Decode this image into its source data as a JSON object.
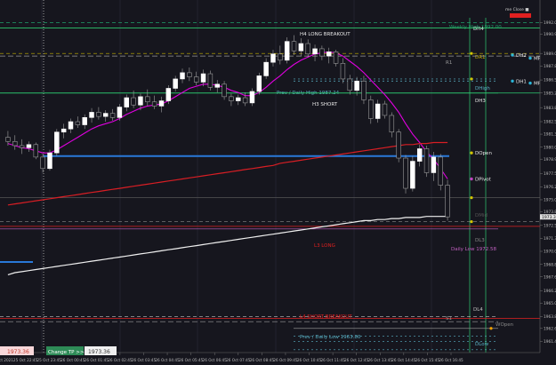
{
  "header": {
    "status": "me Close ■"
  },
  "price_axis": {
    "ticks": [
      1992.0,
      1990.9,
      1989.05,
      1987.85,
      1986.5,
      1985.25,
      1983.85,
      1982.5,
      1981.3,
      1980.05,
      1978.9,
      1977.5,
      1976.25,
      1975.0,
      1973.85,
      1972.55,
      1971.3,
      1970.05,
      1968.8,
      1967.6,
      1966.25,
      1965.05,
      1963.8,
      1962.65,
      1961.4
    ]
  },
  "time_axis": {
    "ticks": [
      "25 Oct 2021",
      "25 Oct 22:45",
      "25 Oct 23:45",
      "26 Oct 00:45",
      "26 Oct 01:45",
      "26 Oct 02:45",
      "26 Oct 03:45",
      "26 Oct 04:45",
      "26 Oct 05:45",
      "26 Oct 06:45",
      "26 Oct 07:45",
      "26 Oct 08:45",
      "26 Oct 09:45",
      "26 Oct 10:45",
      "26 Oct 11:45",
      "26 Oct 12:45",
      "26 Oct 13:45",
      "26 Oct 14:45",
      "26 Oct 15:45",
      "26 Oct 16:45"
    ]
  },
  "bottom_bar": {
    "left_value": "1973.36",
    "tp_label": "Change TP >>>>",
    "tp_value": "1973.36"
  },
  "chart_data": {
    "type": "candlestick",
    "title": "",
    "ylim": [
      1960.5,
      1993.5
    ],
    "grid": false,
    "candles": [
      {
        "o": 1981.0,
        "h": 1981.6,
        "l": 1980.2,
        "c": 1980.6
      },
      {
        "o": 1980.6,
        "h": 1981.2,
        "l": 1979.8,
        "c": 1980.2
      },
      {
        "o": 1980.2,
        "h": 1980.8,
        "l": 1979.4,
        "c": 1980.0
      },
      {
        "o": 1980.0,
        "h": 1980.6,
        "l": 1979.6,
        "c": 1980.3
      },
      {
        "o": 1980.3,
        "h": 1980.5,
        "l": 1978.9,
        "c": 1979.1
      },
      {
        "o": 1979.1,
        "h": 1979.4,
        "l": 1977.6,
        "c": 1978.0
      },
      {
        "o": 1978.0,
        "h": 1979.8,
        "l": 1977.8,
        "c": 1979.5
      },
      {
        "o": 1979.5,
        "h": 1981.8,
        "l": 1979.2,
        "c": 1981.5
      },
      {
        "o": 1981.5,
        "h": 1982.3,
        "l": 1980.9,
        "c": 1981.8
      },
      {
        "o": 1981.8,
        "h": 1982.8,
        "l": 1981.4,
        "c": 1982.5
      },
      {
        "o": 1982.5,
        "h": 1983.0,
        "l": 1981.9,
        "c": 1982.2
      },
      {
        "o": 1982.2,
        "h": 1983.2,
        "l": 1981.8,
        "c": 1982.9
      },
      {
        "o": 1982.9,
        "h": 1983.8,
        "l": 1982.4,
        "c": 1983.4
      },
      {
        "o": 1983.4,
        "h": 1983.9,
        "l": 1982.7,
        "c": 1983.0
      },
      {
        "o": 1983.0,
        "h": 1983.6,
        "l": 1982.5,
        "c": 1983.3
      },
      {
        "o": 1983.3,
        "h": 1983.7,
        "l": 1982.6,
        "c": 1982.9
      },
      {
        "o": 1982.9,
        "h": 1984.2,
        "l": 1982.6,
        "c": 1983.9
      },
      {
        "o": 1983.9,
        "h": 1985.1,
        "l": 1983.5,
        "c": 1984.8
      },
      {
        "o": 1984.8,
        "h": 1985.5,
        "l": 1983.8,
        "c": 1984.1
      },
      {
        "o": 1984.1,
        "h": 1985.2,
        "l": 1983.6,
        "c": 1984.9
      },
      {
        "o": 1984.9,
        "h": 1985.6,
        "l": 1984.0,
        "c": 1984.4
      },
      {
        "o": 1984.4,
        "h": 1985.0,
        "l": 1983.7,
        "c": 1984.0
      },
      {
        "o": 1984.0,
        "h": 1984.9,
        "l": 1983.4,
        "c": 1984.5
      },
      {
        "o": 1984.5,
        "h": 1986.0,
        "l": 1984.2,
        "c": 1985.7
      },
      {
        "o": 1985.7,
        "h": 1986.9,
        "l": 1985.4,
        "c": 1986.6
      },
      {
        "o": 1986.6,
        "h": 1987.6,
        "l": 1986.2,
        "c": 1987.2
      },
      {
        "o": 1987.2,
        "h": 1987.7,
        "l": 1986.4,
        "c": 1986.8
      },
      {
        "o": 1986.8,
        "h": 1987.3,
        "l": 1986.0,
        "c": 1986.3
      },
      {
        "o": 1986.3,
        "h": 1987.5,
        "l": 1985.9,
        "c": 1987.1
      },
      {
        "o": 1987.1,
        "h": 1987.4,
        "l": 1985.5,
        "c": 1985.8
      },
      {
        "o": 1985.8,
        "h": 1986.5,
        "l": 1985.3,
        "c": 1986.1
      },
      {
        "o": 1986.1,
        "h": 1986.4,
        "l": 1984.6,
        "c": 1984.9
      },
      {
        "o": 1984.9,
        "h": 1985.2,
        "l": 1984.0,
        "c": 1984.5
      },
      {
        "o": 1984.5,
        "h": 1985.1,
        "l": 1984.1,
        "c": 1984.8
      },
      {
        "o": 1984.8,
        "h": 1985.3,
        "l": 1984.0,
        "c": 1984.3
      },
      {
        "o": 1984.3,
        "h": 1985.7,
        "l": 1984.0,
        "c": 1985.4
      },
      {
        "o": 1985.4,
        "h": 1987.2,
        "l": 1985.1,
        "c": 1986.9
      },
      {
        "o": 1986.9,
        "h": 1988.6,
        "l": 1986.6,
        "c": 1988.2
      },
      {
        "o": 1988.2,
        "h": 1989.4,
        "l": 1987.8,
        "c": 1989.0
      },
      {
        "o": 1989.0,
        "h": 1989.8,
        "l": 1988.0,
        "c": 1988.4
      },
      {
        "o": 1988.4,
        "h": 1990.6,
        "l": 1988.1,
        "c": 1990.2
      },
      {
        "o": 1990.2,
        "h": 1990.8,
        "l": 1988.9,
        "c": 1989.3
      },
      {
        "o": 1989.3,
        "h": 1990.5,
        "l": 1988.8,
        "c": 1990.0
      },
      {
        "o": 1990.0,
        "h": 1990.4,
        "l": 1988.7,
        "c": 1989.0
      },
      {
        "o": 1989.0,
        "h": 1989.9,
        "l": 1988.3,
        "c": 1989.5
      },
      {
        "o": 1989.5,
        "h": 1989.8,
        "l": 1988.4,
        "c": 1988.8
      },
      {
        "o": 1988.8,
        "h": 1989.6,
        "l": 1988.1,
        "c": 1989.2
      },
      {
        "o": 1989.2,
        "h": 1989.4,
        "l": 1987.8,
        "c": 1988.1
      },
      {
        "o": 1988.1,
        "h": 1988.6,
        "l": 1986.2,
        "c": 1986.6
      },
      {
        "o": 1986.6,
        "h": 1987.0,
        "l": 1985.1,
        "c": 1985.5
      },
      {
        "o": 1985.5,
        "h": 1986.8,
        "l": 1985.0,
        "c": 1986.4
      },
      {
        "o": 1986.4,
        "h": 1986.9,
        "l": 1984.2,
        "c": 1984.6
      },
      {
        "o": 1984.6,
        "h": 1985.0,
        "l": 1982.3,
        "c": 1982.8
      },
      {
        "o": 1982.8,
        "h": 1984.6,
        "l": 1982.4,
        "c": 1984.2
      },
      {
        "o": 1984.2,
        "h": 1984.5,
        "l": 1982.8,
        "c": 1983.1
      },
      {
        "o": 1983.1,
        "h": 1983.4,
        "l": 1981.0,
        "c": 1981.5
      },
      {
        "o": 1981.5,
        "h": 1981.8,
        "l": 1978.6,
        "c": 1979.0
      },
      {
        "o": 1979.0,
        "h": 1979.3,
        "l": 1975.6,
        "c": 1976.1
      },
      {
        "o": 1976.1,
        "h": 1979.2,
        "l": 1975.8,
        "c": 1978.7
      },
      {
        "o": 1978.7,
        "h": 1980.3,
        "l": 1978.2,
        "c": 1979.9
      },
      {
        "o": 1979.9,
        "h": 1980.2,
        "l": 1977.2,
        "c": 1977.6
      },
      {
        "o": 1977.6,
        "h": 1979.6,
        "l": 1976.8,
        "c": 1979.1
      },
      {
        "o": 1979.1,
        "h": 1979.4,
        "l": 1975.9,
        "c": 1976.4
      },
      {
        "o": 1976.4,
        "h": 1976.9,
        "l": 1973.0,
        "c": 1973.36
      }
    ],
    "indicators": [
      {
        "name": "",
        "color": "#e000e0",
        "values": [
          1980.4,
          1980.2,
          1980.0,
          1979.9,
          1979.7,
          1979.5,
          1979.5,
          1979.8,
          1980.2,
          1980.6,
          1981.0,
          1981.4,
          1981.8,
          1982.1,
          1982.3,
          1982.5,
          1982.8,
          1983.2,
          1983.5,
          1983.8,
          1984.0,
          1984.1,
          1984.2,
          1984.5,
          1984.9,
          1985.3,
          1985.7,
          1985.9,
          1986.1,
          1986.1,
          1986.0,
          1985.8,
          1985.5,
          1985.3,
          1985.0,
          1985.0,
          1985.3,
          1985.8,
          1986.4,
          1986.9,
          1987.5,
          1988.0,
          1988.4,
          1988.7,
          1989.0,
          1989.1,
          1989.2,
          1989.1,
          1988.8,
          1988.3,
          1987.8,
          1987.2,
          1986.5,
          1985.8,
          1985.1,
          1984.3,
          1983.4,
          1982.3,
          1981.3,
          1980.5,
          1979.6,
          1978.9,
          1978.0,
          1977.0
        ]
      },
      {
        "name": "",
        "color": "#d81e24",
        "values": [
          1974.5,
          1974.6,
          1974.7,
          1974.8,
          1974.9,
          1975.0,
          1975.1,
          1975.2,
          1975.3,
          1975.4,
          1975.5,
          1975.6,
          1975.7,
          1975.8,
          1975.9,
          1976.0,
          1976.1,
          1976.2,
          1976.3,
          1976.4,
          1976.5,
          1976.6,
          1976.7,
          1976.8,
          1976.9,
          1977.0,
          1977.1,
          1977.2,
          1977.3,
          1977.4,
          1977.5,
          1977.6,
          1977.7,
          1977.8,
          1977.9,
          1978.0,
          1978.1,
          1978.2,
          1978.3,
          1978.5,
          1978.6,
          1978.7,
          1978.8,
          1978.9,
          1979.0,
          1979.1,
          1979.2,
          1979.3,
          1979.4,
          1979.5,
          1979.6,
          1979.7,
          1979.8,
          1979.9,
          1980.0,
          1980.1,
          1980.2,
          1980.3,
          1980.3,
          1980.4,
          1980.4,
          1980.5,
          1980.5,
          1980.5
        ]
      },
      {
        "name": "",
        "color": "#f0f0f0",
        "values": [
          1967.8,
          1968.0,
          1968.1,
          1968.2,
          1968.3,
          1968.4,
          1968.5,
          1968.6,
          1968.7,
          1968.8,
          1968.9,
          1969.0,
          1969.1,
          1969.2,
          1969.3,
          1969.4,
          1969.5,
          1969.6,
          1969.7,
          1969.8,
          1969.9,
          1970.0,
          1970.1,
          1970.2,
          1970.3,
          1970.4,
          1970.5,
          1970.6,
          1970.7,
          1970.8,
          1970.9,
          1971.0,
          1971.1,
          1971.2,
          1971.3,
          1971.4,
          1971.5,
          1971.6,
          1971.7,
          1971.8,
          1971.9,
          1972.0,
          1972.1,
          1972.2,
          1972.3,
          1972.4,
          1972.5,
          1972.6,
          1972.7,
          1972.8,
          1972.9,
          1973.0,
          1973.0,
          1973.1,
          1973.1,
          1973.2,
          1973.2,
          1973.3,
          1973.3,
          1973.3,
          1973.4,
          1973.4,
          1973.4,
          1973.4
        ]
      }
    ],
    "levels": [
      {
        "name": "Weekly High",
        "label": "Weekly High 1992.00",
        "value": 1992.0,
        "color": "#1e9e6a",
        "dash": "4,3"
      },
      {
        "name": "DH4",
        "label": "DH4",
        "value": 1991.5,
        "color": "#2ecc71",
        "dash": ""
      },
      {
        "name": "H4 LONG BREAKOUT",
        "label": "H4 LONG BREAKOUT",
        "value": 1991.5,
        "color": "#2ecc71",
        "dash": ""
      },
      {
        "name": "DR1",
        "label": "DR1",
        "value": 1989.05,
        "color": "#c8b400",
        "dash": "4,3"
      },
      {
        "name": "R1",
        "label": "R1",
        "value": 1988.8,
        "color": "#9a9a9a",
        "dash": "6,3"
      },
      {
        "name": "DHigh",
        "label": "DHigh",
        "value": 1986.6,
        "color": "#5ab4c8",
        "dash": "2,3"
      },
      {
        "name": "Prev / Daily High",
        "label": "Prev / Daily High 1987.24",
        "value": 1986.4,
        "color": "#5ab4c8",
        "dash": "2,3"
      },
      {
        "name": "DH3",
        "label": "DH3",
        "value": 1985.25,
        "color": "#2ecc71",
        "dash": ""
      },
      {
        "name": "H3 SHORT",
        "label": "H3 SHORT",
        "value": 1985.25,
        "color": "#2ecc71",
        "dash": ""
      },
      {
        "name": "Pivot line",
        "label": "",
        "value": 1979.2,
        "color": "#2979d9",
        "dash": ""
      },
      {
        "name": "DMid",
        "label": "DMid",
        "value": 1975.2,
        "color": "#555",
        "dash": ""
      },
      {
        "name": "DL3",
        "label": "DL3",
        "value": 1972.9,
        "color": "#888",
        "dash": "4,3"
      },
      {
        "name": "L3 LONG",
        "label": "L3 LONG",
        "value": 1972.45,
        "color": "#e02020",
        "dash": ""
      },
      {
        "name": "Daily Low",
        "label": "Daily Low 1972.58",
        "value": 1972.2,
        "color": "#c060c0",
        "dash": ""
      },
      {
        "name": "DL4",
        "label": "DL4",
        "value": 1963.8,
        "color": "#c0c0c0",
        "dash": "4,3"
      },
      {
        "name": "L4 SHORT BREAKOUT",
        "label": "L4 SHORT BREAKOUT",
        "value": 1963.6,
        "color": "#e02020",
        "dash": ""
      },
      {
        "name": "S1",
        "label": "S1",
        "value": 1963.3,
        "color": "#9a9a9a",
        "dash": "6,3"
      },
      {
        "name": "WOpen",
        "label": "WOpen",
        "value": 1962.65,
        "color": "#888",
        "dash": ""
      },
      {
        "name": "Prev / Daily Low",
        "label": "Prev / Daily Low 1963.80",
        "value": 1961.9,
        "color": "#5ab4c8",
        "dash": "2,3"
      },
      {
        "name": "DLow",
        "label": "DLow",
        "value": 1961.4,
        "color": "#5ab4c8",
        "dash": "2,3"
      },
      {
        "name": "WLow",
        "label": "WLow",
        "value": 1960.6,
        "color": "#5ab4c8",
        "dash": "2,3"
      }
    ],
    "markers": [
      {
        "label": "DOpen",
        "value": 1979.5,
        "color": "#d4c400"
      },
      {
        "label": "DPivot",
        "value": 1977.0,
        "color": "#c040c0"
      },
      {
        "label": "MR2",
        "value": 1988.6,
        "color": "#2bb5d8"
      },
      {
        "label": "MR2",
        "value": 1986.2,
        "color": "#2bb5d8"
      },
      {
        "label": "DH2",
        "value": 1988.9,
        "color": "#2bb5d8"
      },
      {
        "label": "DH1",
        "value": 1986.4,
        "color": "#2bb5d8"
      }
    ]
  }
}
